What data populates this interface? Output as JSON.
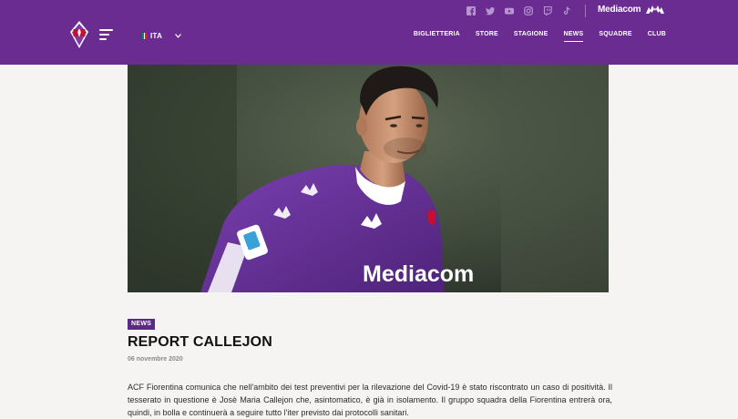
{
  "header": {
    "language": "ITA",
    "brand_sponsor": "Mediacom",
    "social_icons": [
      "facebook-icon",
      "twitter-icon",
      "youtube-icon",
      "instagram-icon",
      "twitch-icon",
      "tiktok-icon"
    ],
    "nav": [
      {
        "label": "BIGLIETTERIA"
      },
      {
        "label": "STORE"
      },
      {
        "label": "STAGIONE"
      },
      {
        "label": "NEWS",
        "active": true
      },
      {
        "label": "SQUADRE"
      },
      {
        "label": "CLUB"
      }
    ],
    "colors": {
      "brand_purple": "#6a2c91",
      "tag_purple": "#5b2a86"
    }
  },
  "hero": {
    "jersey_text": "Mediacom"
  },
  "article": {
    "category": "NEWS",
    "title": "REPORT CALLEJON",
    "date": "06 novembre 2020",
    "body": "ACF Fiorentina comunica che nell'ambito dei test preventivi per la rilevazione del Covid-19 è stato riscontrato un caso di positività. Il tesserato in questione è Josè Maria Callejon che, asintomatico, è già in isolamento. Il gruppo squadra della Fiorentina entrerà ora, quindi, in bolla e continuerà a seguire tutto l'iter previsto dai protocolli sanitari."
  }
}
